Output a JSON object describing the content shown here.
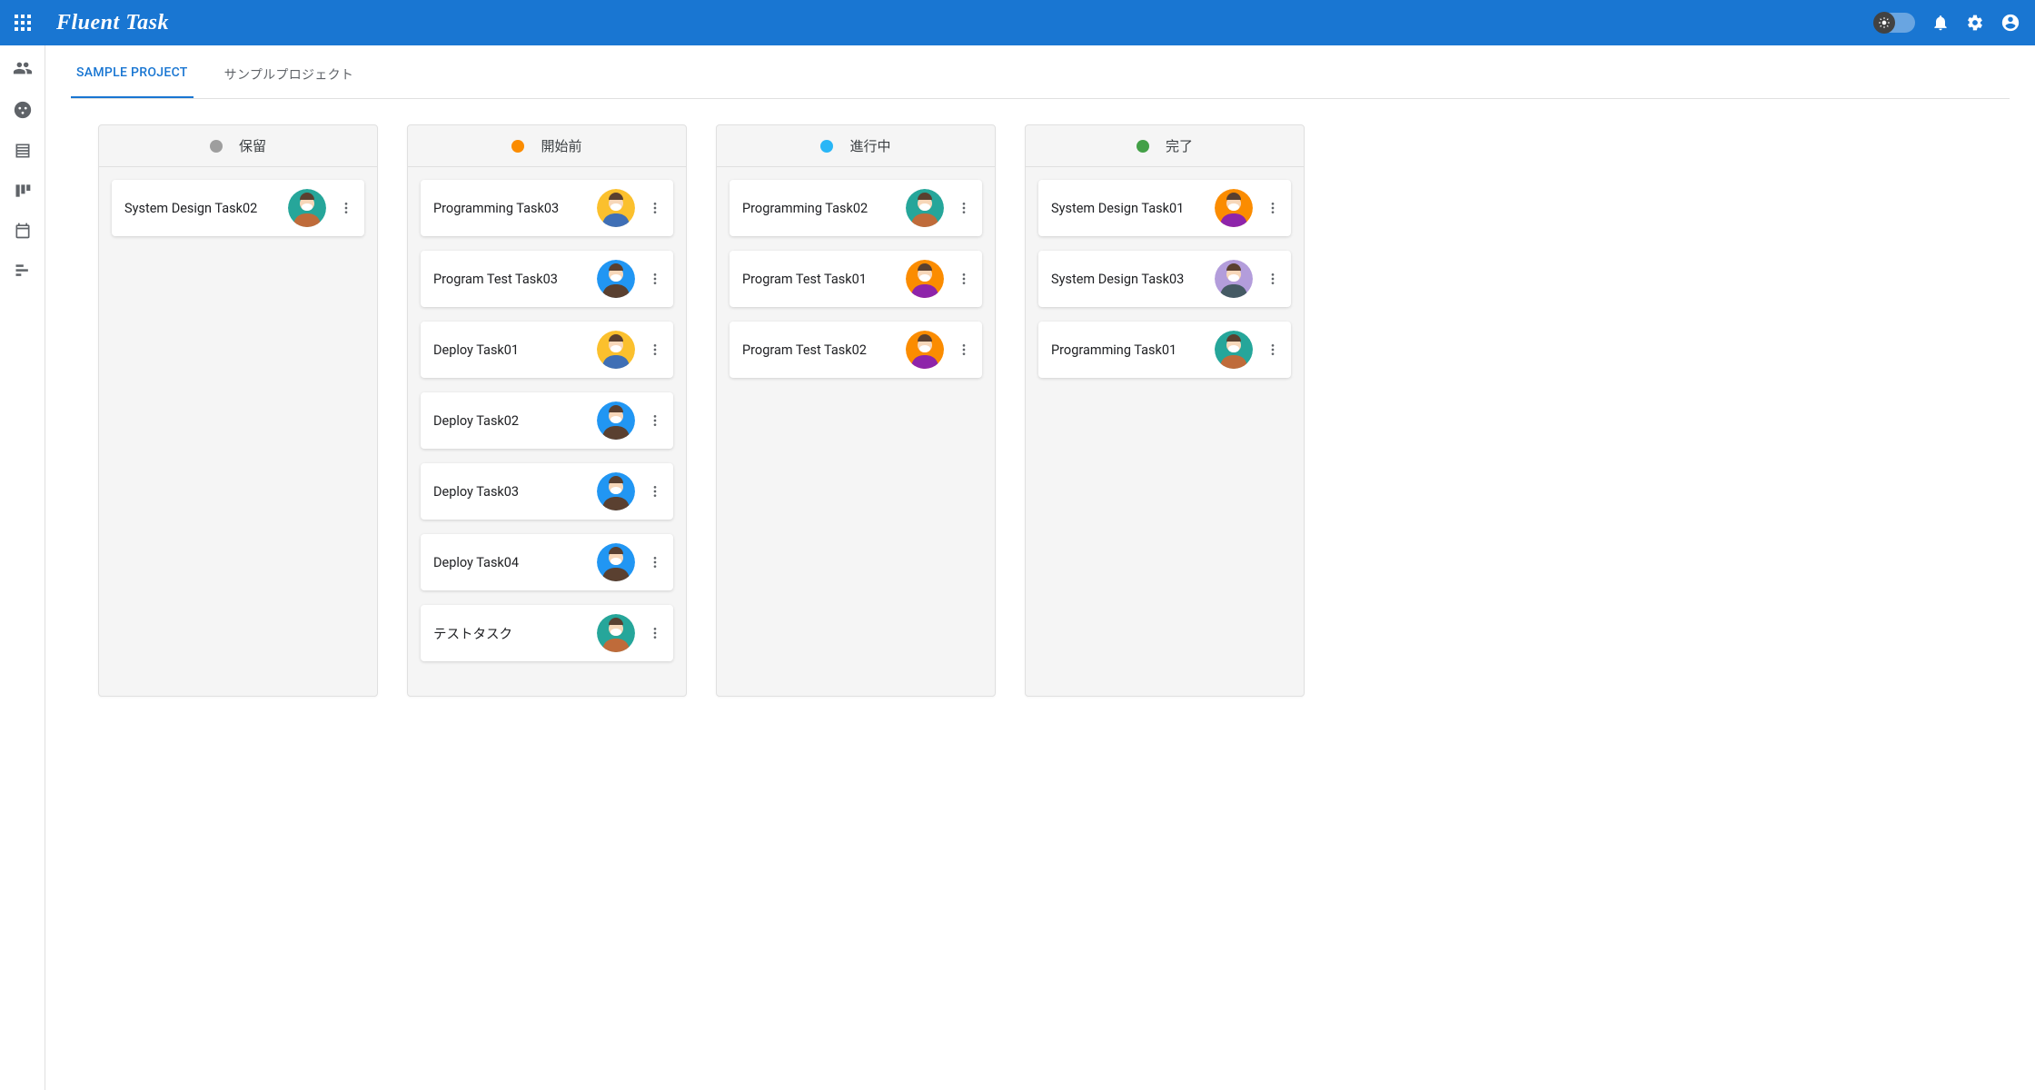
{
  "header": {
    "brand": "Fluent Task"
  },
  "tabs": [
    {
      "label": "SAMPLE PROJECT",
      "active": true
    },
    {
      "label": "サンプルプロジェクト",
      "active": false
    }
  ],
  "avatar_palette": {
    "teal": {
      "bg": "#26a69a",
      "shirt": "#bf6b3a"
    },
    "yellow": {
      "bg": "#fbc02d",
      "shirt": "#3f6fb5"
    },
    "blue": {
      "bg": "#2196f3",
      "shirt": "#5a4030"
    },
    "orange": {
      "bg": "#fb8c00",
      "shirt": "#8e24aa"
    },
    "lav": {
      "bg": "#b39ddb",
      "shirt": "#455a64"
    }
  },
  "columns": [
    {
      "id": "hold",
      "title": "保留",
      "color": "#9e9e9e",
      "cards": [
        {
          "title": "System Design Task02",
          "avatar": "teal"
        }
      ]
    },
    {
      "id": "not-started",
      "title": "開始前",
      "color": "#fb8c00",
      "cards": [
        {
          "title": "Programming Task03",
          "avatar": "yellow"
        },
        {
          "title": "Program Test Task03",
          "avatar": "blue"
        },
        {
          "title": "Deploy Task01",
          "avatar": "yellow"
        },
        {
          "title": "Deploy Task02",
          "avatar": "blue"
        },
        {
          "title": "Deploy Task03",
          "avatar": "blue"
        },
        {
          "title": "Deploy Task04",
          "avatar": "blue"
        },
        {
          "title": "テストタスク",
          "avatar": "teal"
        }
      ]
    },
    {
      "id": "in-progress",
      "title": "進行中",
      "color": "#29b6f6",
      "cards": [
        {
          "title": "Programming Task02",
          "avatar": "teal"
        },
        {
          "title": "Program Test Task01",
          "avatar": "orange"
        },
        {
          "title": "Program Test Task02",
          "avatar": "orange"
        }
      ]
    },
    {
      "id": "done",
      "title": "完了",
      "color": "#43a047",
      "cards": [
        {
          "title": "System Design Task01",
          "avatar": "orange"
        },
        {
          "title": "System Design Task03",
          "avatar": "lav"
        },
        {
          "title": "Programming Task01",
          "avatar": "teal"
        }
      ]
    }
  ]
}
